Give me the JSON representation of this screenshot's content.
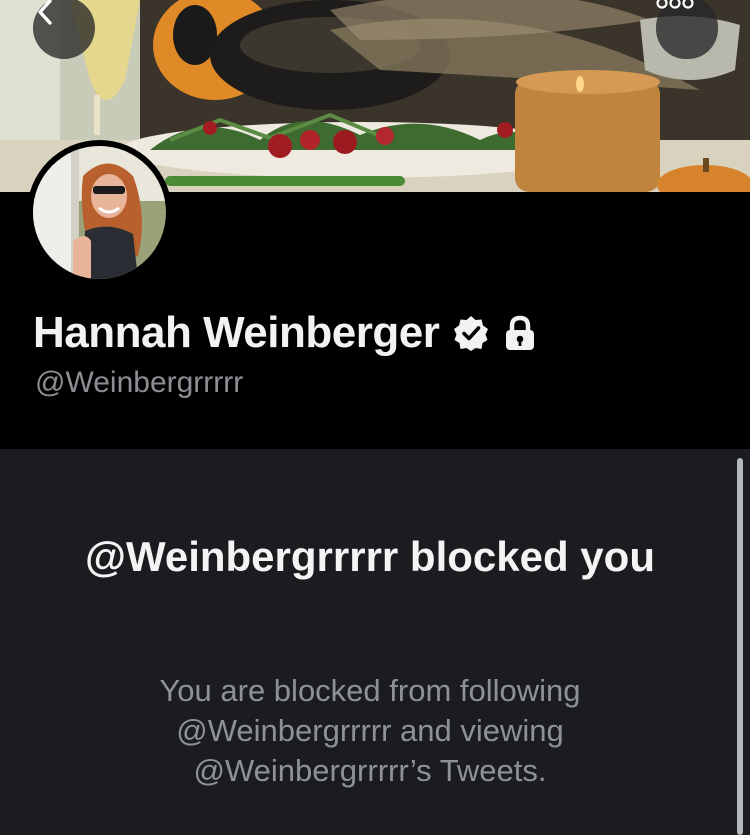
{
  "profile": {
    "display_name": "Hannah Weinberger",
    "handle": "@Weinbergrrrrr"
  },
  "icons": {
    "back": "chevron-left-icon",
    "more": "more-horizontal-icon",
    "verified": "verified-badge-icon",
    "protected": "lock-icon"
  },
  "blocked_notice": {
    "title": "@Weinbergrrrrr blocked you",
    "description": "You are blocked from following @Weinbergrrrrr and viewing @Weinbergrrrrr’s Tweets."
  },
  "colors": {
    "background": "#000000",
    "content_background": "#1b1c1f",
    "name_text": "#f2f2f2",
    "secondary_text": "#8e9297"
  }
}
